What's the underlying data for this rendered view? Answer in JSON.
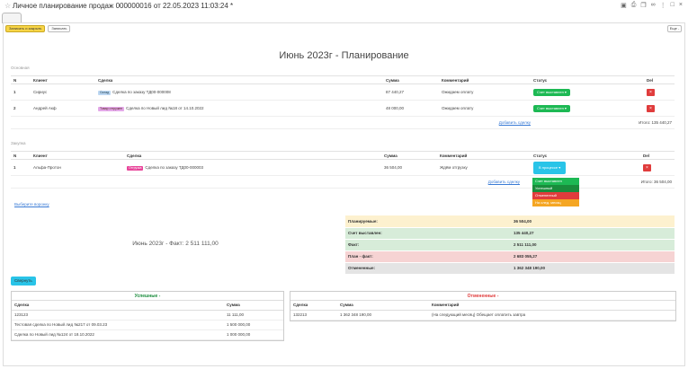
{
  "window": {
    "title": "Личное планирование продаж 000000016 от 22.05.2023 11:03:24 *"
  },
  "toolbar": {
    "save_close": "Записать и закрыть",
    "save": "Записать",
    "more": "Еще -"
  },
  "main_title": "Июнь 2023г - Планирование",
  "osnovnaya": {
    "label": "Основная",
    "headers": [
      "N",
      "Клиент",
      "Сделка",
      "Сумма",
      "Комментарий",
      "Статус",
      "Del"
    ],
    "rows": [
      {
        "n": "1",
        "client": "Сириус",
        "badge": "Склад",
        "deal": "Сделка по заказу ТД00-000008",
        "sum": "87 440,27",
        "comment": "Ожидаем оплату",
        "status": "Счет выставлен",
        "del": "×"
      },
      {
        "n": "2",
        "client": "Андрей Акф",
        "badge": "Товар отгружен",
        "deal": "Сделка по Новый лид №18 от 14.10.2022",
        "sum": "48 000,00",
        "comment": "Ожидаем оплату",
        "status": "Счет выставлен",
        "del": "×"
      }
    ],
    "add_link": "Добавить сделку",
    "total": "Итого: 135 440,27"
  },
  "zakupka": {
    "label": "Закупка",
    "headers": [
      "N",
      "Клиент",
      "Сделка",
      "Сумма",
      "Комментарий",
      "Статус",
      "Del"
    ],
    "rows": [
      {
        "n": "1",
        "client": "Альфа-Протон",
        "badge": "Отгрузка",
        "deal": "Сделка по заказу ТД00-000003",
        "sum": "36 504,00",
        "comment": "Ждём отгрузку",
        "status": "В процессе",
        "del": "×"
      }
    ],
    "add_link": "Добавить сделку",
    "total": "Итого: 36 504,00"
  },
  "dropdown": {
    "options": [
      {
        "label": "Счет выставлен",
        "color": "#1db954"
      },
      {
        "label": "Успешный",
        "color": "#1a8c3c"
      },
      {
        "label": "Отмененный",
        "color": "#e03c3c"
      },
      {
        "label": "На след. месяц",
        "color": "#f5a623"
      }
    ]
  },
  "choose_funnel": "Выберите воронку",
  "fact_title": "Июнь 2023г - Факт: 2 511 111,00",
  "summary": [
    {
      "label": "Планируемые:",
      "value": "36 504,00",
      "color": "#fdf1cf"
    },
    {
      "label": "Счет выставлен:",
      "value": "135 440,27",
      "color": "#d7ecd9"
    },
    {
      "label": "Факт:",
      "value": "2 511 111,00",
      "color": "#d7ecd9"
    },
    {
      "label": "План - факт:",
      "value": "2 683 055,27",
      "color": "#f6d3d3"
    },
    {
      "label": "Отмененные:",
      "value": "1 362 348 190,00",
      "color": "#e4e4e4"
    }
  ],
  "collapse_button": "Свернуть",
  "successful": {
    "title": "Успешные -",
    "headers": [
      "Сделка",
      "Сумма"
    ],
    "rows": [
      [
        "123123",
        "11 111,00"
      ],
      [
        "Тестовая сделка по Новый лид №217 от 09.03.23",
        "1 500 000,00"
      ],
      [
        "Сделка по Новый лид №124 от 18.10.2022",
        "1 000 000,00"
      ]
    ]
  },
  "cancelled": {
    "title": "Отмененные -",
    "headers": [
      "Сделка",
      "Сумма",
      "Комментарий"
    ],
    "rows": [
      [
        "132213",
        "1 362 348 190,00",
        "(На следующий месяц) Обещает оплатить завтра"
      ]
    ]
  }
}
